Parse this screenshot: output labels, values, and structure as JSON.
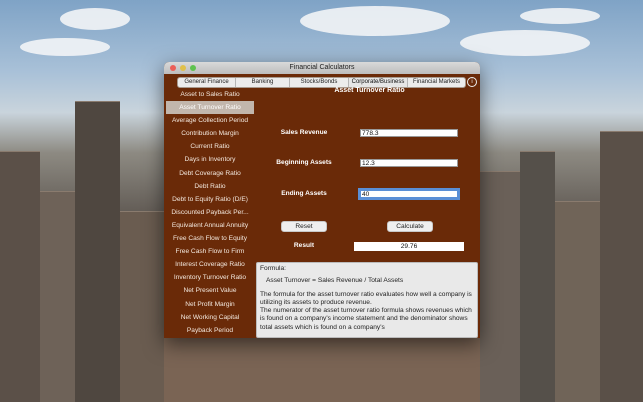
{
  "window": {
    "title": "Financial Calculators"
  },
  "tabs": [
    {
      "label": "General Finance"
    },
    {
      "label": "Banking"
    },
    {
      "label": "Stocks/Bonds"
    },
    {
      "label": "Corporate/Business"
    },
    {
      "label": "Financial Markets"
    }
  ],
  "sidebar": {
    "items": [
      {
        "label": "Asset to Sales Ratio"
      },
      {
        "label": "Asset Turnover Ratio"
      },
      {
        "label": "Average Collection Period"
      },
      {
        "label": "Contribution Margin"
      },
      {
        "label": "Current Ratio"
      },
      {
        "label": "Days in Inventory"
      },
      {
        "label": "Debt Coverage Ratio"
      },
      {
        "label": "Debt Ratio"
      },
      {
        "label": "Debt to Equity Ratio (D/E)"
      },
      {
        "label": "Discounted Payback Per..."
      },
      {
        "label": "Equivalent Annual Annuity"
      },
      {
        "label": "Free Cash Flow to Equity"
      },
      {
        "label": "Free Cash Flow to Firm"
      },
      {
        "label": "Interest Coverage Ratio"
      },
      {
        "label": "Inventory Turnover Ratio"
      },
      {
        "label": "Net Present Value"
      },
      {
        "label": "Net Profit Margin"
      },
      {
        "label": "Net Working Capital"
      },
      {
        "label": "Payback Period"
      }
    ]
  },
  "panel": {
    "title": "Asset Turnover Ratio",
    "sales_label": "Sales Revenue",
    "sales_value": "778.3",
    "beginning_label": "Beginning Assets",
    "beginning_value": "12.3",
    "ending_label": "Ending Assets",
    "ending_value": "40",
    "reset_label": "Reset",
    "calculate_label": "Calculate",
    "result_label": "Result",
    "result_value": "29.76"
  },
  "formula": {
    "heading": "Formula:",
    "equation": "Asset Turnover = Sales Revenue / Total Assets",
    "desc1": "The formula for the asset turnover ratio evaluates how well a company is utilizing its assets to produce revenue.",
    "desc2": "The numerator of the asset turnover ratio formula shows revenues which is found on a company's income statement and the denominator shows total assets which is found on a company's"
  }
}
